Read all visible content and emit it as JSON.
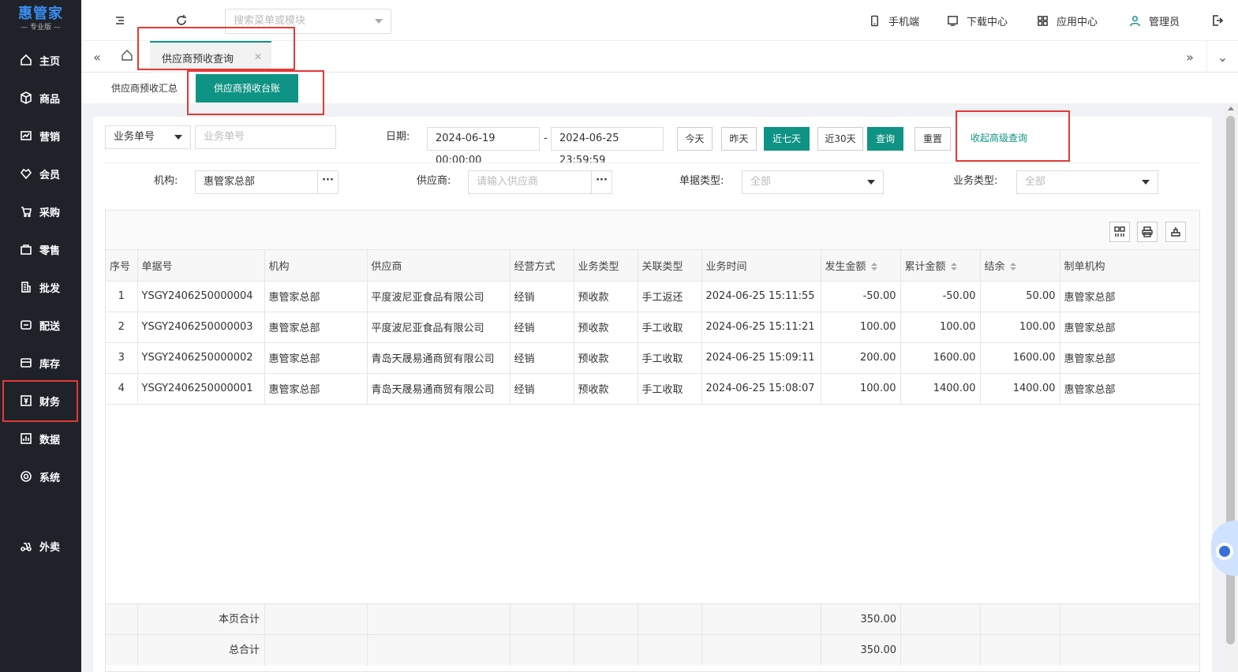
{
  "brand": {
    "name": "惠管家",
    "edition": "专业版"
  },
  "nav": [
    {
      "label": "主页",
      "icon": "home-icon"
    },
    {
      "label": "商品",
      "icon": "box-icon"
    },
    {
      "label": "营销",
      "icon": "chart-icon"
    },
    {
      "label": "会员",
      "icon": "heart-icon"
    },
    {
      "label": "采购",
      "icon": "cart-icon"
    },
    {
      "label": "零售",
      "icon": "bag-icon"
    },
    {
      "label": "批发",
      "icon": "building-icon"
    },
    {
      "label": "配送",
      "icon": "truck-icon"
    },
    {
      "label": "库存",
      "icon": "warehouse-icon"
    },
    {
      "label": "财务",
      "icon": "finance-icon"
    },
    {
      "label": "数据",
      "icon": "data-icon"
    },
    {
      "label": "系统",
      "icon": "settings-icon"
    },
    {
      "label": "外卖",
      "icon": "delivery-icon"
    }
  ],
  "topbar": {
    "search_placeholder": "搜索菜单或模块",
    "mobile": "手机端",
    "download": "下载中心",
    "apps": "应用中心",
    "user": "管理员"
  },
  "tabs": {
    "active": "供应商预收查询"
  },
  "subtabs": [
    "供应商预收汇总",
    "供应商预收台账"
  ],
  "filters": {
    "doc_select": "业务单号",
    "doc_placeholder": "业务单号",
    "date_label": "日期:",
    "date_start": "2024-06-19 00:00:00",
    "date_sep": "-",
    "date_end": "2024-06-25 23:59:59",
    "btn_today": "今天",
    "btn_yesterday": "昨天",
    "btn_7days": "近七天",
    "btn_30days": "近30天",
    "btn_query": "查询",
    "btn_reset": "重置",
    "collapse_link": "收起高级查询",
    "org_label": "机构:",
    "org_value": "惠管家总部",
    "supplier_label": "供应商:",
    "supplier_placeholder": "请输入供应商",
    "doctype_label": "单据类型:",
    "doctype_value": "全部",
    "biztype_label": "业务类型:",
    "biztype_value": "全部",
    "dots": "···"
  },
  "table": {
    "headers": [
      "序号",
      "单据号",
      "机构",
      "供应商",
      "经营方式",
      "业务类型",
      "关联类型",
      "业务时间",
      "发生金额",
      "累计金额",
      "结余",
      "制单机构"
    ],
    "rows": [
      [
        "1",
        "YSGY2406250000004",
        "惠管家总部",
        "平度波尼亚食品有限公司",
        "经销",
        "预收款",
        "手工返还",
        "2024-06-25 15:11:55",
        "-50.00",
        "-50.00",
        "50.00",
        "惠管家总部"
      ],
      [
        "2",
        "YSGY2406250000003",
        "惠管家总部",
        "平度波尼亚食品有限公司",
        "经销",
        "预收款",
        "手工收取",
        "2024-06-25 15:11:21",
        "100.00",
        "100.00",
        "100.00",
        "惠管家总部"
      ],
      [
        "3",
        "YSGY2406250000002",
        "惠管家总部",
        "青岛天晟易通商贸有限公司",
        "经销",
        "预收款",
        "手工收取",
        "2024-06-25 15:09:11",
        "200.00",
        "1600.00",
        "1600.00",
        "惠管家总部"
      ],
      [
        "4",
        "YSGY2406250000001",
        "惠管家总部",
        "青岛天晟易通商贸有限公司",
        "经销",
        "预收款",
        "手工收取",
        "2024-06-25 15:08:07",
        "100.00",
        "1400.00",
        "1400.00",
        "惠管家总部"
      ]
    ],
    "page_total_label": "本页合计",
    "page_total_value": "350.00",
    "grand_total_label": "总合计",
    "grand_total_value": "350.00"
  },
  "colors": {
    "accent": "#0e9384",
    "sidebar": "#1f2329",
    "highlight": "#e53935"
  }
}
